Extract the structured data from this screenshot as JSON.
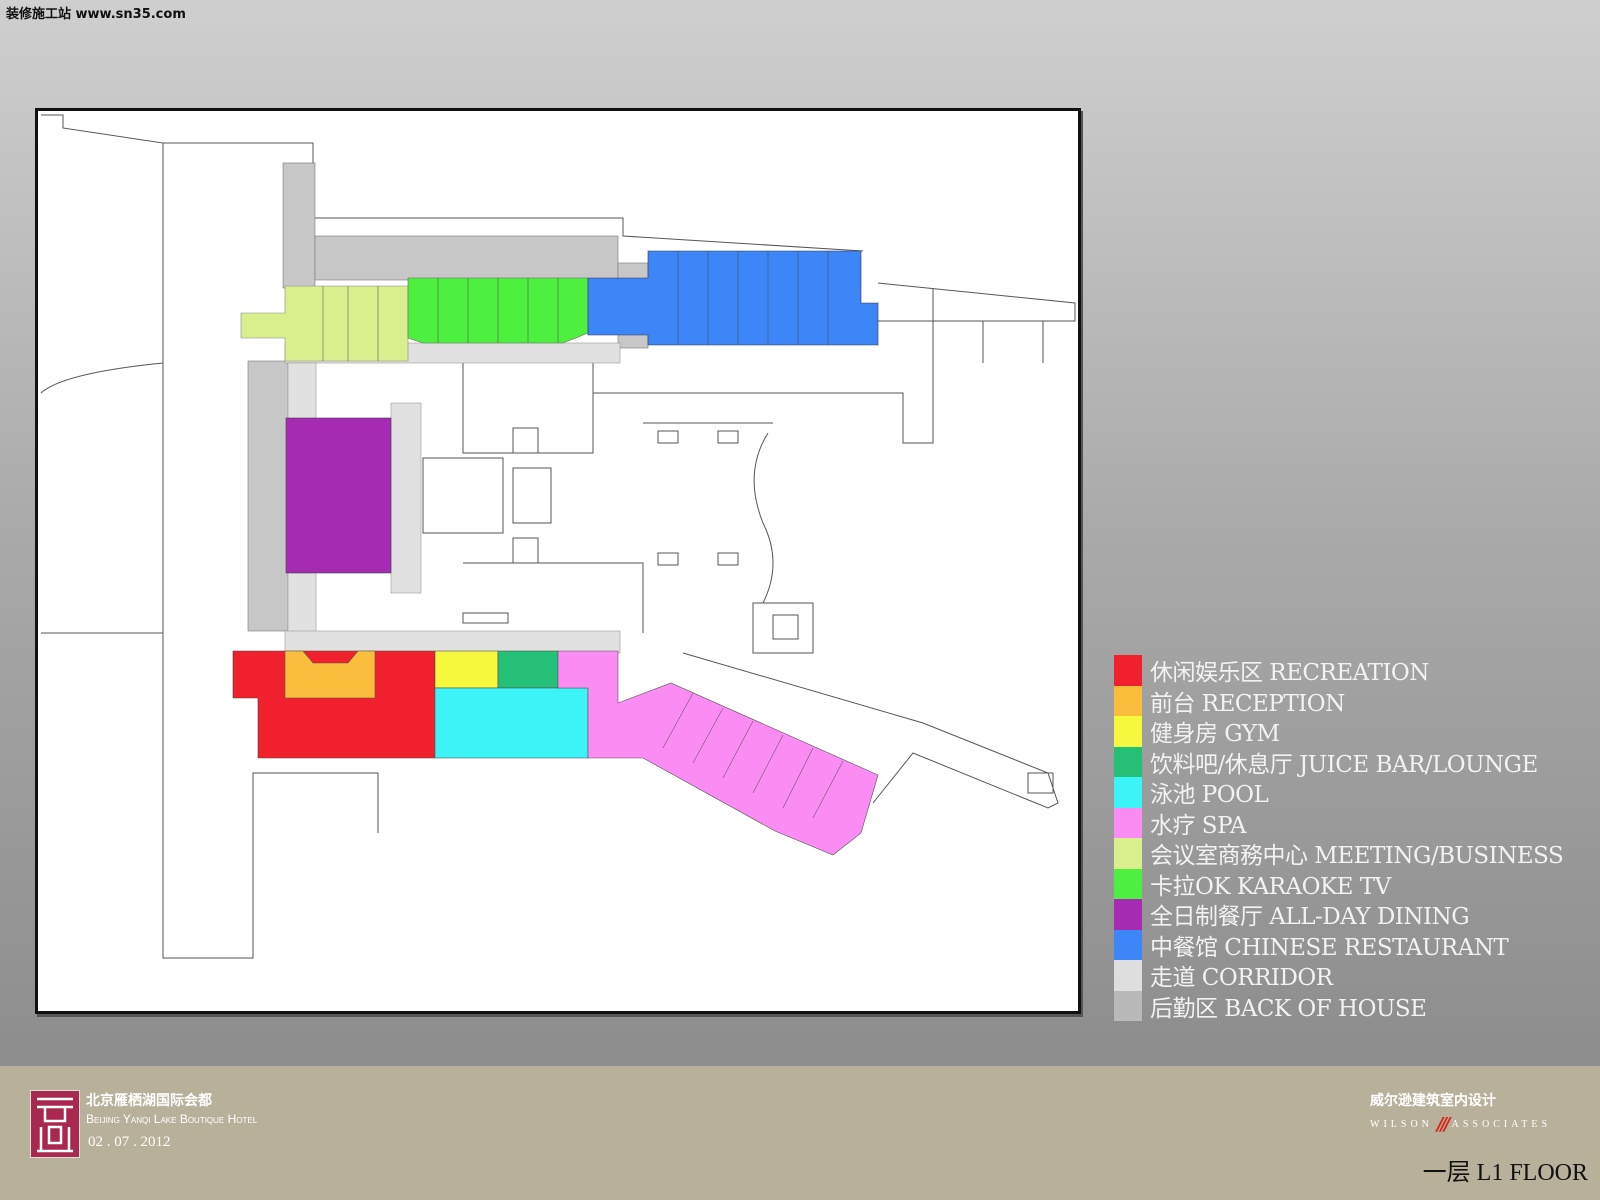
{
  "watermark": "装修施工站 www.sn35.com",
  "legend": [
    {
      "label": "休闲娱乐区 RECREATION",
      "color": "#f0212c"
    },
    {
      "label": "前台 RECEPTION",
      "color": "#fbbd3c"
    },
    {
      "label": "健身房 GYM",
      "color": "#f5f83c"
    },
    {
      "label": "饮料吧/休息厅 JUICE BAR/LOUNGE",
      "color": "#25c077"
    },
    {
      "label": "泳池 POOL",
      "color": "#3cf4f8"
    },
    {
      "label": "水疗 SPA",
      "color": "#fb8cf3"
    },
    {
      "label": "会议室商務中心 MEETING/BUSINESS",
      "color": "#d9ee8c"
    },
    {
      "label": "卡拉OK KARAOKE TV",
      "color": "#4ef040"
    },
    {
      "label": "全日制餐厅 ALL-DAY DINING",
      "color": "#a42bb2"
    },
    {
      "label": "中餐馆 CHINESE RESTAURANT",
      "color": "#3d86f8"
    },
    {
      "label": "走道 CORRIDOR",
      "color": "#dedede"
    },
    {
      "label": "后勤区 BACK OF HOUSE",
      "color": "#b9b9b9"
    }
  ],
  "footer": {
    "hotel_cn": "北京雁栖湖国际会都",
    "hotel_en": "Beijing Yanqi Lake Boutique Hotel",
    "date": "02 . 07 . 2012",
    "firm_cn": "威尔逊建筑室内设计",
    "firm_left": "WILSON",
    "firm_right": "ASSOCIATES",
    "floor": "一层 L1 FLOOR"
  }
}
